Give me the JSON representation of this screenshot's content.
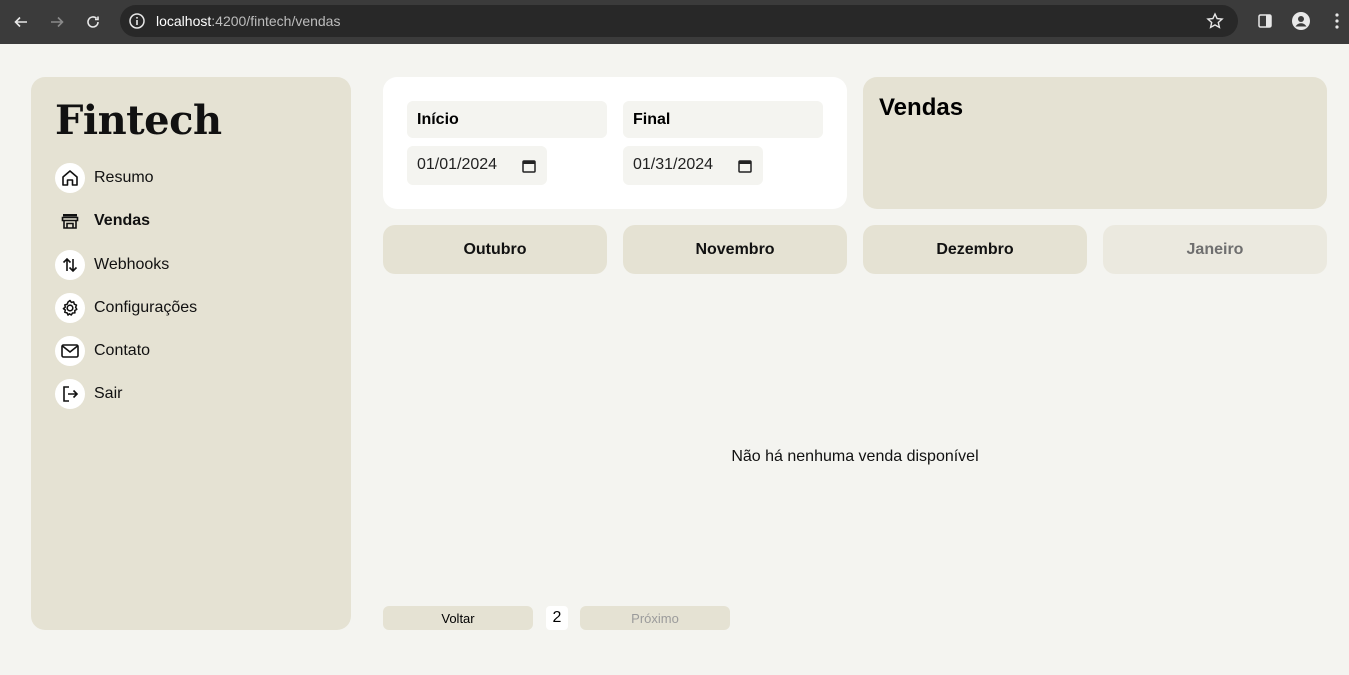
{
  "browser": {
    "url_host": "localhost",
    "url_path": ":4200/fintech/vendas"
  },
  "sidebar": {
    "logo": "Fintech",
    "items": [
      {
        "label": "Resumo",
        "icon": "home-icon"
      },
      {
        "label": "Vendas",
        "icon": "store-icon",
        "active": true
      },
      {
        "label": "Webhooks",
        "icon": "arrows-updown-icon"
      },
      {
        "label": "Configurações",
        "icon": "gear-icon"
      },
      {
        "label": "Contato",
        "icon": "mail-icon"
      },
      {
        "label": "Sair",
        "icon": "logout-icon"
      }
    ]
  },
  "filters": {
    "start_label": "Início",
    "start_value": "01/01/2024",
    "end_label": "Final",
    "end_value": "01/31/2024"
  },
  "vendas_card": {
    "title": "Vendas"
  },
  "months": [
    {
      "label": "Outubro"
    },
    {
      "label": "Novembro"
    },
    {
      "label": "Dezembro"
    },
    {
      "label": "Janeiro",
      "current": true
    }
  ],
  "main": {
    "empty_message": "Não há nenhuma venda disponível"
  },
  "pagination": {
    "prev_label": "Voltar",
    "page": "2",
    "next_label": "Próximo"
  },
  "colors": {
    "page_bg": "#f4f4f0",
    "card_beige": "#e5e2d3",
    "chrome_bg": "#3b3b3b"
  }
}
